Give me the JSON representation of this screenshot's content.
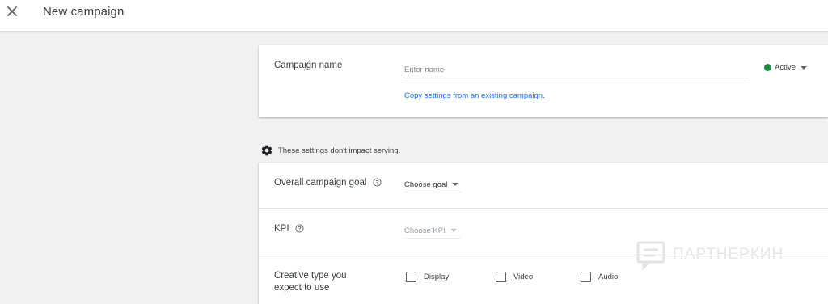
{
  "header": {
    "close_icon": "close-icon",
    "title": "New campaign"
  },
  "campaign_name": {
    "label": "Campaign name",
    "placeholder": "Enter name",
    "value": "",
    "status": {
      "label": "Active",
      "color": "#1e8e3e"
    },
    "copy_link": "Copy settings from an existing campaign."
  },
  "settings_note": {
    "icon": "gear-icon",
    "text": "These settings don't impact serving."
  },
  "goal_section": {
    "goal": {
      "label": "Overall campaign goal",
      "select": "Choose goal"
    },
    "kpi": {
      "label": "KPI",
      "select": "Choose KPI"
    },
    "creative": {
      "label_line1": "Creative type you",
      "label_line2": "expect to use",
      "options": [
        {
          "label": "Display",
          "checked": false
        },
        {
          "label": "Video",
          "checked": false
        },
        {
          "label": "Audio",
          "checked": false
        }
      ]
    }
  },
  "watermark": {
    "text": "ПАРТНЕРКИН"
  },
  "colors": {
    "accent_link": "#1a73e8",
    "active_green": "#1e8e3e",
    "background": "#f1f1f1"
  }
}
